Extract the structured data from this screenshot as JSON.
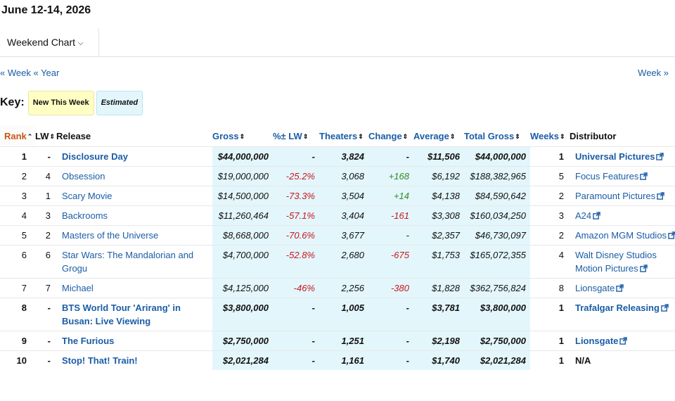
{
  "page_title": "June 12-14, 2026",
  "tab": {
    "label": "Weekend Chart"
  },
  "nav": {
    "prev_week": "« Week",
    "prev_year": "« Year",
    "next_week": "Week »"
  },
  "key": {
    "label": "Key:",
    "new": "New This Week",
    "estimated": "Estimated"
  },
  "headers": {
    "rank": "Rank",
    "lw": "LW",
    "release": "Release",
    "gross": "Gross",
    "pct_lw": "%± LW",
    "theaters": "Theaters",
    "change": "Change",
    "average": "Average",
    "total_gross": "Total Gross",
    "weeks": "Weeks",
    "distributor": "Distributor"
  },
  "rows": [
    {
      "rank": "1",
      "lw": "-",
      "release": "Disclosure Day",
      "gross": "$44,000,000",
      "pct": "-",
      "theaters": "3,824",
      "change": "-",
      "average": "$11,506",
      "total": "$44,000,000",
      "weeks": "1",
      "distributor": "Universal Pictures",
      "new": true,
      "ext": true
    },
    {
      "rank": "2",
      "lw": "4",
      "release": "Obsession",
      "gross": "$19,000,000",
      "pct": "-25.2%",
      "theaters": "3,068",
      "change": "+168",
      "average": "$6,192",
      "total": "$188,382,965",
      "weeks": "5",
      "distributor": "Focus Features",
      "new": false,
      "ext": true
    },
    {
      "rank": "3",
      "lw": "1",
      "release": "Scary Movie",
      "gross": "$14,500,000",
      "pct": "-73.3%",
      "theaters": "3,504",
      "change": "+14",
      "average": "$4,138",
      "total": "$84,590,642",
      "weeks": "2",
      "distributor": "Paramount Pictures",
      "new": false,
      "ext": true
    },
    {
      "rank": "4",
      "lw": "3",
      "release": "Backrooms",
      "gross": "$11,260,464",
      "pct": "-57.1%",
      "theaters": "3,404",
      "change": "-161",
      "average": "$3,308",
      "total": "$160,034,250",
      "weeks": "3",
      "distributor": "A24",
      "new": false,
      "ext": true
    },
    {
      "rank": "5",
      "lw": "2",
      "release": "Masters of the Universe",
      "gross": "$8,668,000",
      "pct": "-70.6%",
      "theaters": "3,677",
      "change": "-",
      "average": "$2,357",
      "total": "$46,730,097",
      "weeks": "2",
      "distributor": "Amazon MGM Studios",
      "new": false,
      "ext": true
    },
    {
      "rank": "6",
      "lw": "6",
      "release": "Star Wars: The Mandalorian and Grogu",
      "gross": "$4,700,000",
      "pct": "-52.8%",
      "theaters": "2,680",
      "change": "-675",
      "average": "$1,753",
      "total": "$165,072,355",
      "weeks": "4",
      "distributor": "Walt Disney Studios Motion Pictures",
      "new": false,
      "ext": true
    },
    {
      "rank": "7",
      "lw": "7",
      "release": "Michael",
      "gross": "$4,125,000",
      "pct": "-46%",
      "theaters": "2,256",
      "change": "-380",
      "average": "$1,828",
      "total": "$362,756,824",
      "weeks": "8",
      "distributor": "Lionsgate",
      "new": false,
      "ext": true
    },
    {
      "rank": "8",
      "lw": "-",
      "release": "BTS World Tour 'Arirang' in Busan: Live Viewing",
      "gross": "$3,800,000",
      "pct": "-",
      "theaters": "1,005",
      "change": "-",
      "average": "$3,781",
      "total": "$3,800,000",
      "weeks": "1",
      "distributor": "Trafalgar Releasing",
      "new": true,
      "ext": true
    },
    {
      "rank": "9",
      "lw": "-",
      "release": "The Furious",
      "gross": "$2,750,000",
      "pct": "-",
      "theaters": "1,251",
      "change": "-",
      "average": "$2,198",
      "total": "$2,750,000",
      "weeks": "1",
      "distributor": "Lionsgate",
      "new": true,
      "ext": true
    },
    {
      "rank": "10",
      "lw": "-",
      "release": "Stop! That! Train!",
      "gross": "$2,021,284",
      "pct": "-",
      "theaters": "1,161",
      "change": "-",
      "average": "$1,740",
      "total": "$2,021,284",
      "weeks": "1",
      "distributor": "N/A",
      "new": true,
      "ext": false
    }
  ],
  "colors": {
    "link": "#1a5da6",
    "estimated_bg": "#e3f6fb",
    "new_bg": "#ffffc4",
    "negative": "#c8171e",
    "positive": "#2e8b24",
    "rank_header": "#c8541a"
  }
}
